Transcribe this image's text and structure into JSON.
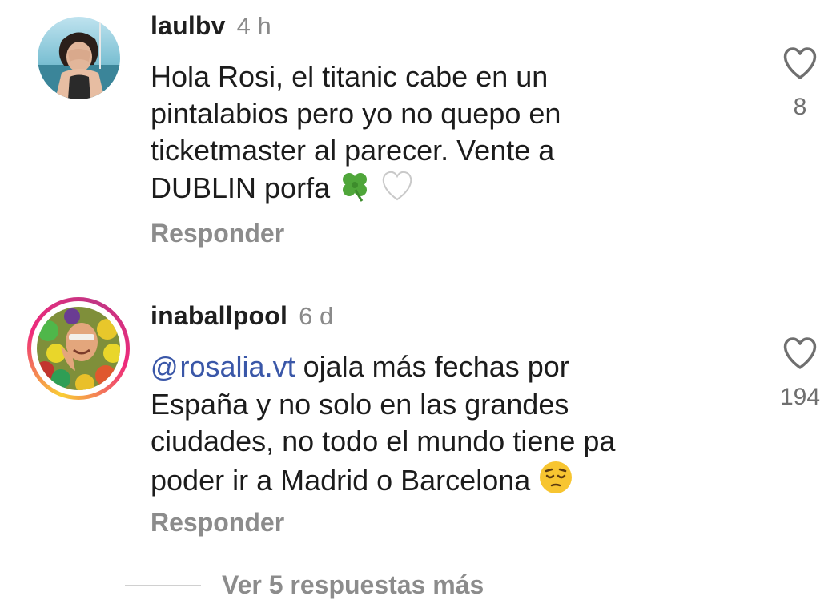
{
  "comments": [
    {
      "username": "laulbv",
      "time": "4 h",
      "text_main": "Hola Rosi, el titanic cabe en un pintalabios pero yo no quepo en ticketmaster al parecer. Vente a DUBLIN porfa",
      "emojis": [
        "four-leaf-clover",
        "white-heart"
      ],
      "reply_label": "Responder",
      "likes": "8"
    },
    {
      "username": "inaballpool",
      "time": "6 d",
      "mention": "rosalia.vt",
      "text_main": "ojala más fechas por España y no solo en las grandes ciudades, no todo el mundo tiene pa poder ir a Madrid o Barcelona",
      "emojis": [
        "pensive-face"
      ],
      "reply_label": "Responder",
      "likes": "194",
      "has_story_ring": true
    }
  ],
  "view_more_label": "Ver 5 respuestas más",
  "colors": {
    "mention": "#3a57a8",
    "muted": "#8c8c8c",
    "story_ring_start": "#f9ce34",
    "story_ring_mid": "#ee2a7b",
    "story_ring_end": "#c13584"
  }
}
